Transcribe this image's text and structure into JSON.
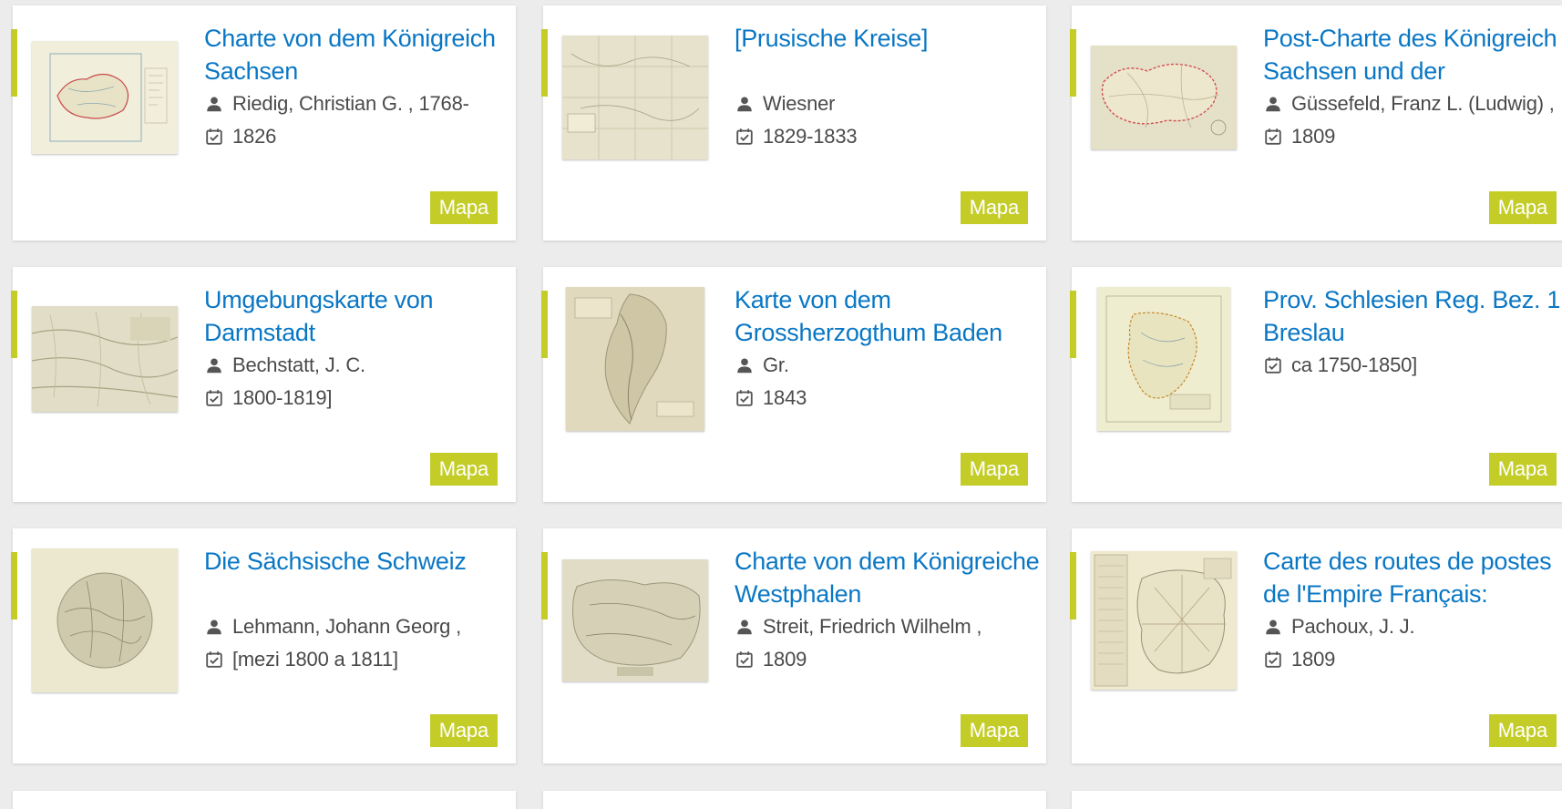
{
  "theme": {
    "title_color": "#0a77c4",
    "accent_color": "#c4cd28",
    "background": "#ececec"
  },
  "icons": {
    "author": "person-icon",
    "date": "calendar-check-icon"
  },
  "results": [
    {
      "title": "Charte von dem Königreich Sachsen",
      "author": "Riedig, Christian G. , 1768-",
      "date": "1826",
      "type": "Mapa"
    },
    {
      "title": "[Prusische Kreise]",
      "author": "Wiesner",
      "date": "1829-1833",
      "type": "Mapa"
    },
    {
      "title": "Post-Charte des Königreich Sachsen und der",
      "author": "Güssefeld, Franz L. (Ludwig) ,",
      "date": "1809",
      "type": "Mapa"
    },
    {
      "title": "Umgebungskarte von Darmstadt",
      "author": "Bechstatt, J. C.",
      "date": "1800-1819]",
      "type": "Mapa"
    },
    {
      "title": "Karte von dem Grossherzogthum Baden",
      "author": "Gr.",
      "date": "1843",
      "type": "Mapa"
    },
    {
      "title": "Prov. Schlesien Reg. Bez. 1. Breslau",
      "author": null,
      "date": "ca 1750-1850]",
      "type": "Mapa"
    },
    {
      "title": "Die Sächsische Schweiz",
      "author": "Lehmann, Johann Georg ,",
      "date": "[mezi 1800 a 1811]",
      "type": "Mapa"
    },
    {
      "title": "Charte von dem Königreiche Westphalen",
      "author": "Streit, Friedrich Wilhelm ,",
      "date": "1809",
      "type": "Mapa"
    },
    {
      "title": "Carte des routes de postes de l'Empire Français:",
      "author": "Pachoux, J. J.",
      "date": "1809",
      "type": "Mapa"
    }
  ]
}
